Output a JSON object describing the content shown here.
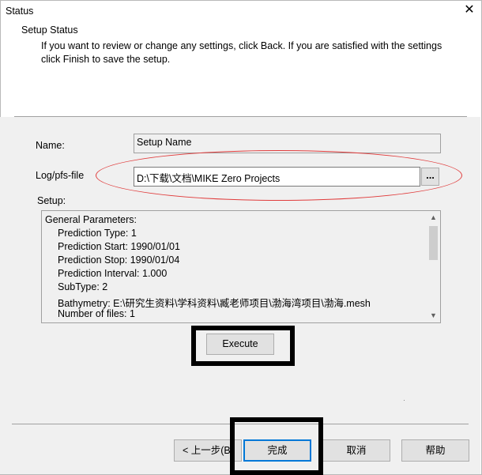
{
  "window": {
    "title": "Status"
  },
  "header": {
    "title": "Setup Status",
    "description": "If you want to review or change any settings, click Back. If you are satisfied with the settings click Finish to save the setup."
  },
  "form": {
    "name_label": "Name:",
    "name_value": "Setup Name",
    "log_label": "Log/pfs-file",
    "log_value": "D:\\下载\\文档\\MIKE Zero Projects",
    "browse_label": "...",
    "setup_label": "Setup:"
  },
  "setup_lines": [
    "General Parameters:",
    "Prediction Type:  1",
    "Prediction Start:  1990/01/01",
    "Prediction Stop:  1990/01/04",
    "Prediction Interval:  1.000",
    "SubType:  2",
    "Bathymetry:   E:\\研究生资料\\学科资料\\臧老师项目\\渤海湾项目\\渤海.mesh",
    "Number of files:  1"
  ],
  "buttons": {
    "execute": "Execute",
    "back": "< 上一步(B)",
    "finish": "完成",
    "cancel": "取消",
    "help": "帮助"
  },
  "colors": {
    "annotation_oval": "#e03c3c",
    "annotation_box": "#000000",
    "default_button_border": "#0078d7"
  }
}
